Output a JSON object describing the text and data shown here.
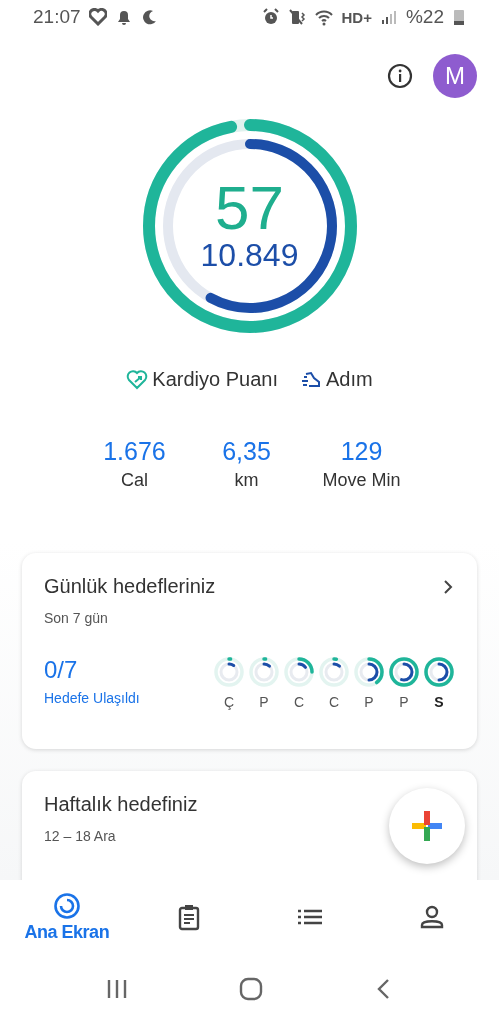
{
  "status_bar": {
    "time": "21:07",
    "network": "HD+",
    "battery": "%22"
  },
  "header": {
    "avatar": "M"
  },
  "summary": {
    "points": "57",
    "steps": "10.849",
    "points_ring": {
      "level": 0.97
    },
    "steps_ring": {
      "level": 0.58
    }
  },
  "legend": [
    {
      "kind": "heart",
      "label": "Kardiyo Puanı"
    },
    {
      "kind": "steps",
      "label": "Adım"
    }
  ],
  "stats": [
    {
      "value": "1.676",
      "label": "Cal"
    },
    {
      "value": "6,35",
      "label": "km"
    },
    {
      "value": "129",
      "label": "Move Min"
    }
  ],
  "daily_goals": {
    "title": "Günlük hedefleriniz",
    "subtitle": "Son 7 gün",
    "count": "0/7",
    "count_label": "Hedefe Ulaşıldı",
    "days": [
      {
        "label": "Ç",
        "selected": false
      },
      {
        "label": "P",
        "selected": false
      },
      {
        "label": "C",
        "selected": false
      },
      {
        "label": "C",
        "selected": false
      },
      {
        "label": "P",
        "selected": false
      },
      {
        "label": "P",
        "selected": false
      },
      {
        "label": "S",
        "selected": true
      }
    ]
  },
  "weekly_goal": {
    "title": "Haftalık hedefiniz",
    "subtitle": "12 – 18 Ara"
  },
  "bottom_nav": [
    {
      "kind": "home",
      "label": "Ana Ekran",
      "selected": true
    },
    {
      "kind": "journal",
      "selected": false
    },
    {
      "kind": "browse",
      "selected": false
    },
    {
      "kind": "profile",
      "selected": false
    }
  ]
}
